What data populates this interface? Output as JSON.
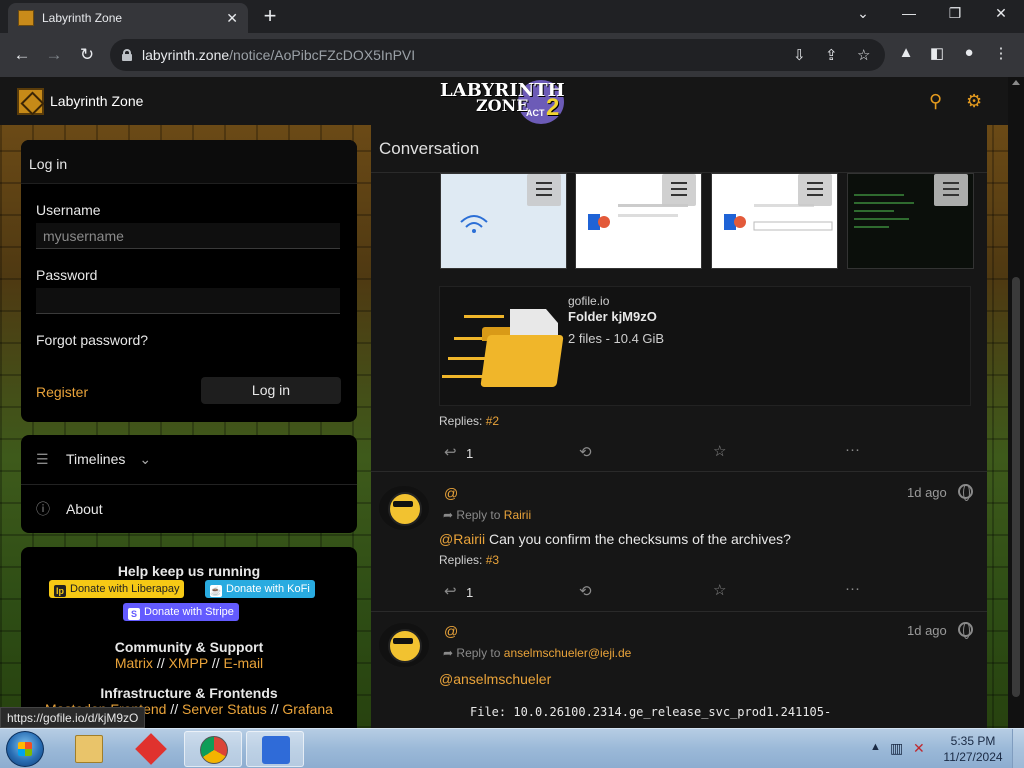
{
  "browser": {
    "tab_title": "Labyrinth Zone",
    "url_host": "labyrinth.zone",
    "url_path": "/notice/AoPibcFZcDOX5InPVI"
  },
  "header": {
    "site_name": "Labyrinth Zone",
    "banner_line1": "LABYRINTH",
    "banner_line2": "ZONE",
    "banner_act": "ACT",
    "banner_num": "2"
  },
  "login": {
    "title": "Log in",
    "username_label": "Username",
    "username_placeholder": "myusername",
    "password_label": "Password",
    "forgot": "Forgot password?",
    "register": "Register",
    "submit": "Log in"
  },
  "nav": {
    "timelines": "Timelines",
    "about": "About"
  },
  "help": {
    "title": "Help keep us running",
    "liberapay": "Donate with Liberapay",
    "kofi": "Donate with KoFi",
    "stripe": "Donate with Stripe",
    "community_title": "Community & Support",
    "community_links": [
      "Matrix",
      "XMPP",
      "E-mail"
    ],
    "infra_title": "Infrastructure & Frontends",
    "infra_links": [
      "Mastodon Frontend",
      "Server Status",
      "Grafana"
    ]
  },
  "main": {
    "title": "Conversation",
    "link_card": {
      "site": "gofile.io",
      "title": "Folder kjM9zO",
      "description": "2 files - 10.4 GiB"
    },
    "notices": [
      {
        "replies_label": "Replies:",
        "replies_num": "#2",
        "reply_count": "1"
      },
      {
        "handle": "@",
        "time": "1d ago",
        "reply_to_label": "Reply to",
        "reply_to": "Rairii",
        "mention": "@Rairii",
        "text": " Can you confirm the checksums of the archives?",
        "replies_label": "Replies:",
        "replies_num": "#3",
        "reply_count": "1"
      },
      {
        "handle": "@",
        "time": "1d ago",
        "reply_to_label": "Reply to",
        "reply_to": "anselmschueler@ieji.de",
        "mention": "@anselmschueler",
        "pre": "File: 10.0.26100.2314.ge_release_svc_prod1.241105-"
      }
    ]
  },
  "status_url": "https://gofile.io/d/kjM9zO",
  "taskbar": {
    "time": "5:35 PM",
    "date": "11/27/2024"
  }
}
